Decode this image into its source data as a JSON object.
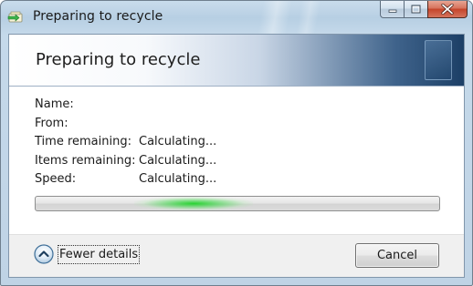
{
  "window": {
    "title": "Preparing to recycle"
  },
  "header": {
    "title": "Preparing to recycle"
  },
  "details": [
    {
      "label": "Name:",
      "value": ""
    },
    {
      "label": "From:",
      "value": ""
    },
    {
      "label": "Time remaining:",
      "value": "Calculating..."
    },
    {
      "label": "Items remaining:",
      "value": "Calculating..."
    },
    {
      "label": "Speed:",
      "value": "Calculating..."
    }
  ],
  "progress": {
    "state": "indeterminate",
    "color": "#22c82a"
  },
  "footer": {
    "toggle_label": "Fewer details",
    "cancel_label": "Cancel"
  },
  "icons": {
    "app": "recycle-progress-icon",
    "toggle": "chevron-up-circle-icon",
    "minimize": "minimize-icon",
    "maximize": "maximize-icon",
    "close": "close-icon"
  },
  "colors": {
    "header_gradient_end": "#1c3f66",
    "close_button": "#c4442a"
  }
}
